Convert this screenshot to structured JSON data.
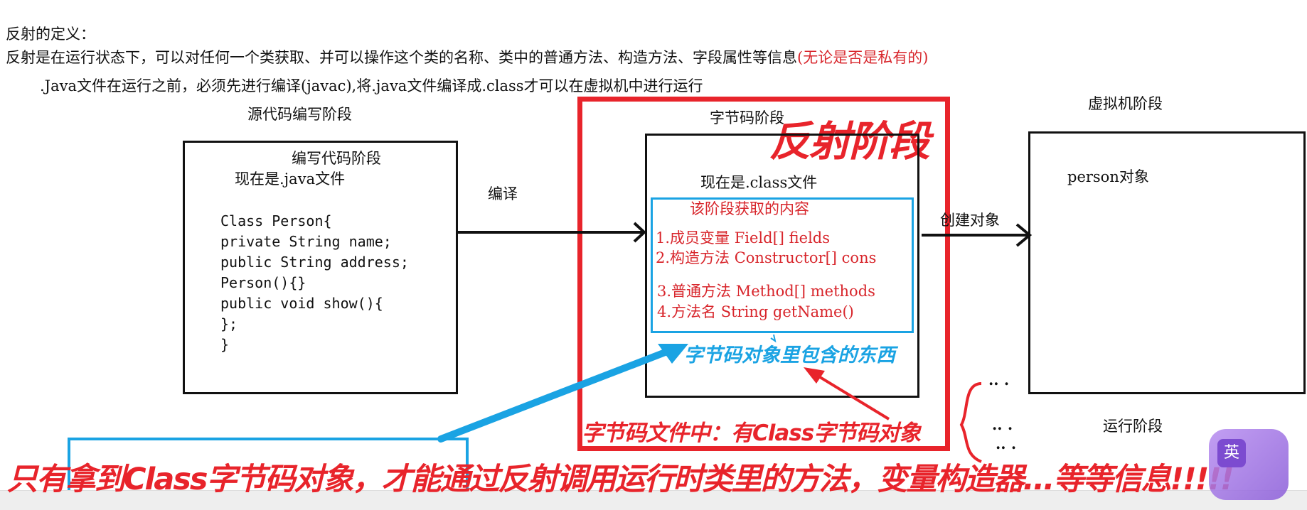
{
  "intro": {
    "heading": "反射的定义：",
    "definition": "反射是在运行状态下，可以对任何一个类获取、并可以操作这个类的名称、类中的普通方法、构造方法、字段属性等信息",
    "definition_red": "(无论是否是私有的)",
    "compile_note": ".Java文件在运行之前，必须先进行编译(javac),将.java文件编译成.class才可以在虚拟机中进行运行"
  },
  "source_stage": {
    "title": "源代码编写阶段",
    "box_title": "编写代码阶段",
    "file_note": "现在是.java文件",
    "code": [
      "Class Person{",
      "private String name;",
      "public String address;",
      "Person(){}",
      "public void show(){",
      "};",
      "}"
    ]
  },
  "compile_label": "编译",
  "bytecode_stage": {
    "title": "字节码阶段",
    "reflection_label": "反射阶段",
    "file_note": "现在是.class文件",
    "acquired_title": "该阶段获取的内容",
    "items": [
      "1.成员变量   Field[] fields",
      "2.构造方法 Constructor[] cons",
      "3.普通方法 Method[] methods",
      "4.方法名   String getName()"
    ],
    "contents_note": "字节码对象里包含的东西",
    "class_object_note": "字节码文件中：有Class字节码对象"
  },
  "create_label": "创建对象",
  "vm_stage": {
    "title": "虚拟机阶段",
    "object_label": "person对象",
    "runtime_label": "运行阶段"
  },
  "ellipsis_marks": [
    "..  .",
    "..  .",
    "..  ."
  ],
  "bottom_banner": "只有拿到Class字节码对象，才能通过反射调用运行时类里的方法，变量构造器...等等信息!!!!!",
  "ime_char": "英",
  "colors": {
    "red": "#e8242b",
    "blue": "#1aa3e3",
    "text_red": "#d8262c",
    "black": "#111111"
  }
}
